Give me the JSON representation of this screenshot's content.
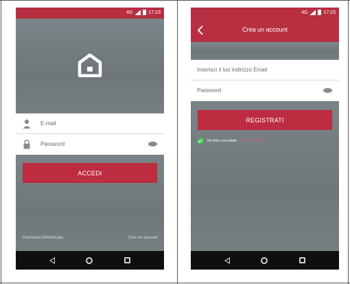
{
  "status_bar": {
    "network": "4G",
    "time": "17:23"
  },
  "login_screen": {
    "email_placeholder": "E-mail",
    "password_placeholder": "Password",
    "login_button": "ACCEDI",
    "forgot_password": "Password dimenticata",
    "create_account": "Crea un account"
  },
  "register_screen": {
    "title": "Crea un account",
    "email_placeholder": "Inserisci il tuo indirizzo Email",
    "password_placeholder": "Password",
    "register_button": "REGISTRATI",
    "terms_prefix": "Ho letto e accettato",
    "terms_link": "Termini e Privacy"
  },
  "colors": {
    "brand_red": "#b82f42",
    "accent_green": "#46c258",
    "background_gray": "#757d81"
  },
  "icons": [
    "home-logo-icon",
    "user-icon",
    "lock-icon",
    "eye-icon",
    "back-arrow-icon",
    "check-icon",
    "nav-back-icon",
    "nav-home-icon",
    "nav-recent-icon",
    "signal-icon",
    "battery-icon"
  ]
}
